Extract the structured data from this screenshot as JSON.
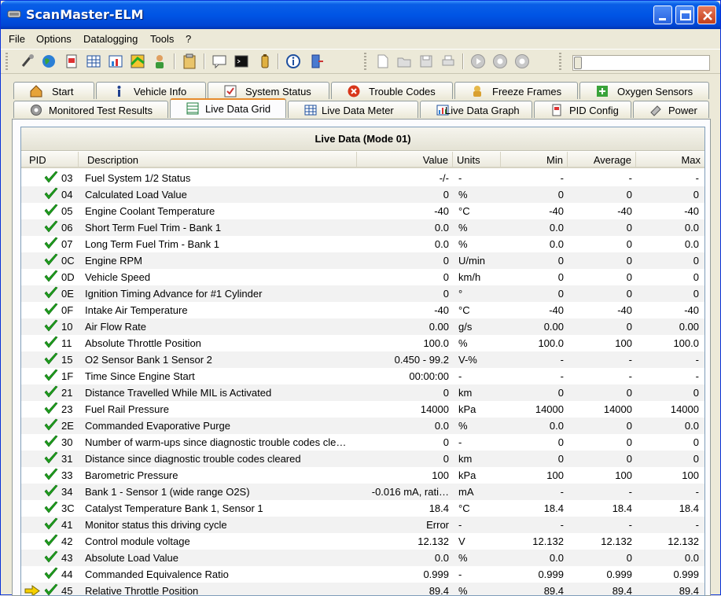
{
  "app": {
    "title": "ScanMaster-ELM"
  },
  "menu": [
    "File",
    "Options",
    "Datalogging",
    "Tools",
    "?"
  ],
  "tabs_row1": [
    {
      "label": "Start",
      "icon": "house-icon"
    },
    {
      "label": "Vehicle Info",
      "icon": "info-icon"
    },
    {
      "label": "System Status",
      "icon": "status-icon"
    },
    {
      "label": "Trouble Codes",
      "icon": "trouble-icon"
    },
    {
      "label": "Freeze Frames",
      "icon": "freeze-icon"
    },
    {
      "label": "Oxygen Sensors",
      "icon": "oxygen-icon"
    }
  ],
  "tabs_row2": [
    {
      "label": "Monitored Test Results",
      "icon": "gear-icon"
    },
    {
      "label": "Live Data Grid",
      "icon": "grid-icon",
      "active": true
    },
    {
      "label": "Live Data Meter",
      "icon": "meter-icon"
    },
    {
      "label": "Live Data Graph",
      "icon": "graph-icon"
    },
    {
      "label": "PID Config",
      "icon": "config-icon"
    },
    {
      "label": "Power",
      "icon": "power-icon"
    }
  ],
  "grid": {
    "title": "Live Data (Mode 01)",
    "headers": {
      "pid": "PID",
      "description": "Description",
      "value": "Value",
      "units": "Units",
      "min": "Min",
      "average": "Average",
      "max": "Max"
    },
    "rows": [
      {
        "pid": "03",
        "description": "Fuel System 1/2 Status",
        "value": "-/-",
        "units": "-",
        "min": "-",
        "average": "-",
        "max": "-"
      },
      {
        "pid": "04",
        "description": "Calculated Load Value",
        "value": "0",
        "units": "%",
        "min": "0",
        "average": "0",
        "max": "0"
      },
      {
        "pid": "05",
        "description": "Engine Coolant Temperature",
        "value": "-40",
        "units": "°C",
        "min": "-40",
        "average": "-40",
        "max": "-40"
      },
      {
        "pid": "06",
        "description": "Short Term Fuel Trim - Bank 1",
        "value": "0.0",
        "units": "%",
        "min": "0.0",
        "average": "0",
        "max": "0.0"
      },
      {
        "pid": "07",
        "description": "Long Term Fuel Trim - Bank 1",
        "value": "0.0",
        "units": "%",
        "min": "0.0",
        "average": "0",
        "max": "0.0"
      },
      {
        "pid": "0C",
        "description": "Engine RPM",
        "value": "0",
        "units": "U/min",
        "min": "0",
        "average": "0",
        "max": "0"
      },
      {
        "pid": "0D",
        "description": "Vehicle Speed",
        "value": "0",
        "units": "km/h",
        "min": "0",
        "average": "0",
        "max": "0"
      },
      {
        "pid": "0E",
        "description": "Ignition Timing Advance for #1 Cylinder",
        "value": "0",
        "units": "°",
        "min": "0",
        "average": "0",
        "max": "0"
      },
      {
        "pid": "0F",
        "description": "Intake Air Temperature",
        "value": "-40",
        "units": "°C",
        "min": "-40",
        "average": "-40",
        "max": "-40"
      },
      {
        "pid": "10",
        "description": "Air Flow Rate",
        "value": "0.00",
        "units": "g/s",
        "min": "0.00",
        "average": "0",
        "max": "0.00"
      },
      {
        "pid": "11",
        "description": "Absolute Throttle Position",
        "value": "100.0",
        "units": "%",
        "min": "100.0",
        "average": "100",
        "max": "100.0"
      },
      {
        "pid": "15",
        "description": "O2 Sensor Bank 1 Sensor 2",
        "value": "0.450 - 99.2",
        "units": "V-%",
        "min": "-",
        "average": "-",
        "max": "-"
      },
      {
        "pid": "1F",
        "description": "Time Since Engine Start",
        "value": "00:00:00",
        "units": "-",
        "min": "-",
        "average": "-",
        "max": "-"
      },
      {
        "pid": "21",
        "description": "Distance Travelled While MIL is Activated",
        "value": "0",
        "units": "km",
        "min": "0",
        "average": "0",
        "max": "0"
      },
      {
        "pid": "23",
        "description": "Fuel Rail Pressure",
        "value": "14000",
        "units": "kPa",
        "min": "14000",
        "average": "14000",
        "max": "14000"
      },
      {
        "pid": "2E",
        "description": "Commanded Evaporative Purge",
        "value": "0.0",
        "units": "%",
        "min": "0.0",
        "average": "0",
        "max": "0.0"
      },
      {
        "pid": "30",
        "description": "Number of warm-ups since diagnostic trouble codes cle…",
        "value": "0",
        "units": "-",
        "min": "0",
        "average": "0",
        "max": "0"
      },
      {
        "pid": "31",
        "description": "Distance since diagnostic trouble codes cleared",
        "value": "0",
        "units": "km",
        "min": "0",
        "average": "0",
        "max": "0"
      },
      {
        "pid": "33",
        "description": "Barometric Pressure",
        "value": "100",
        "units": "kPa",
        "min": "100",
        "average": "100",
        "max": "100"
      },
      {
        "pid": "34",
        "description": "Bank 1 - Sensor 1 (wide range O2S)",
        "value": "-0.016 mA, rati…",
        "units": "mA",
        "min": "-",
        "average": "-",
        "max": "-"
      },
      {
        "pid": "3C",
        "description": "Catalyst Temperature Bank 1, Sensor 1",
        "value": "18.4",
        "units": "°C",
        "min": "18.4",
        "average": "18.4",
        "max": "18.4"
      },
      {
        "pid": "41",
        "description": "Monitor status this driving cycle",
        "value": "Error",
        "units": "-",
        "min": "-",
        "average": "-",
        "max": "-"
      },
      {
        "pid": "42",
        "description": "Control module voltage",
        "value": "12.132",
        "units": "V",
        "min": "12.132",
        "average": "12.132",
        "max": "12.132"
      },
      {
        "pid": "43",
        "description": "Absolute Load Value",
        "value": "0.0",
        "units": "%",
        "min": "0.0",
        "average": "0",
        "max": "0.0"
      },
      {
        "pid": "44",
        "description": "Commanded Equivalence Ratio",
        "value": "0.999",
        "units": "-",
        "min": "0.999",
        "average": "0.999",
        "max": "0.999"
      },
      {
        "pid": "45",
        "description": "Relative Throttle Position",
        "value": "89.4",
        "units": "%",
        "min": "89.4",
        "average": "89.4",
        "max": "89.4",
        "current": true
      }
    ]
  },
  "colors": {
    "check": "#1fa01f",
    "arrow": "#f5d000",
    "titlebar": "#0055e5",
    "active_tab_accent": "#e68b2c"
  }
}
